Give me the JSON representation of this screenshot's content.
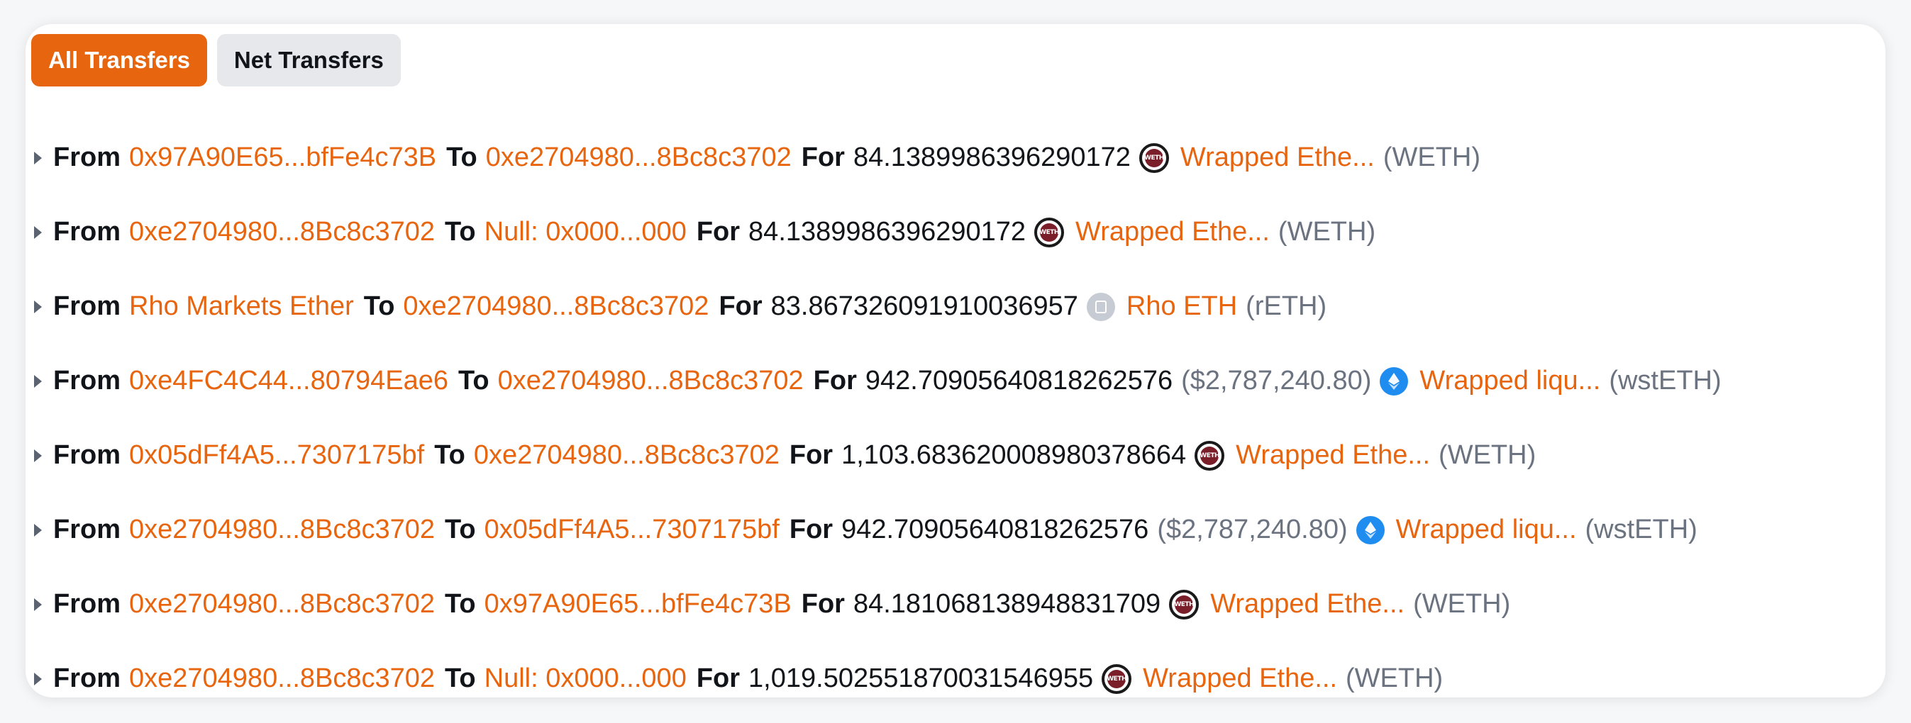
{
  "tabs": [
    {
      "label": "All Transfers",
      "active": true
    },
    {
      "label": "Net Transfers",
      "active": false
    }
  ],
  "labels": {
    "from": "From",
    "to": "To",
    "for": "For"
  },
  "colors": {
    "accent": "#e8650f",
    "text": "#111418",
    "muted": "#6b7280"
  },
  "transfers": [
    {
      "from": "0x97A90E65...bfFe4c73B",
      "to": "0xe2704980...8Bc8c3702",
      "amount": "84.1389986396290172",
      "usd": "",
      "token_icon": "weth-icon",
      "token_name": "Wrapped Ethe...",
      "token_symbol": "(WETH)"
    },
    {
      "from": "0xe2704980...8Bc8c3702",
      "to": "Null: 0x000...000",
      "amount": "84.1389986396290172",
      "usd": "",
      "token_icon": "weth-icon",
      "token_name": "Wrapped Ethe...",
      "token_symbol": "(WETH)"
    },
    {
      "from": "Rho Markets Ether",
      "to": "0xe2704980...8Bc8c3702",
      "amount": "83.867326091910036957",
      "usd": "",
      "token_icon": "reth-icon",
      "token_name": "Rho ETH",
      "token_symbol": "(rETH)"
    },
    {
      "from": "0xe4FC4C44...80794Eae6",
      "to": "0xe2704980...8Bc8c3702",
      "amount": "942.70905640818262576",
      "usd": "($2,787,240.80)",
      "token_icon": "wsteth-icon",
      "token_name": "Wrapped liqu...",
      "token_symbol": "(wstETH)"
    },
    {
      "from": "0x05dFf4A5...7307175bf",
      "to": "0xe2704980...8Bc8c3702",
      "amount": "1,103.683620008980378664",
      "usd": "",
      "token_icon": "weth-icon",
      "token_name": "Wrapped Ethe...",
      "token_symbol": "(WETH)"
    },
    {
      "from": "0xe2704980...8Bc8c3702",
      "to": "0x05dFf4A5...7307175bf",
      "amount": "942.70905640818262576",
      "usd": "($2,787,240.80)",
      "token_icon": "wsteth-icon",
      "token_name": "Wrapped liqu...",
      "token_symbol": "(wstETH)"
    },
    {
      "from": "0xe2704980...8Bc8c3702",
      "to": "0x97A90E65...bfFe4c73B",
      "amount": "84.181068138948831709",
      "usd": "",
      "token_icon": "weth-icon",
      "token_name": "Wrapped Ethe...",
      "token_symbol": "(WETH)"
    },
    {
      "from": "0xe2704980...8Bc8c3702",
      "to": "Null: 0x000...000",
      "amount": "1,019.502551870031546955",
      "usd": "",
      "token_icon": "weth-icon",
      "token_name": "Wrapped Ethe...",
      "token_symbol": "(WETH)"
    }
  ]
}
